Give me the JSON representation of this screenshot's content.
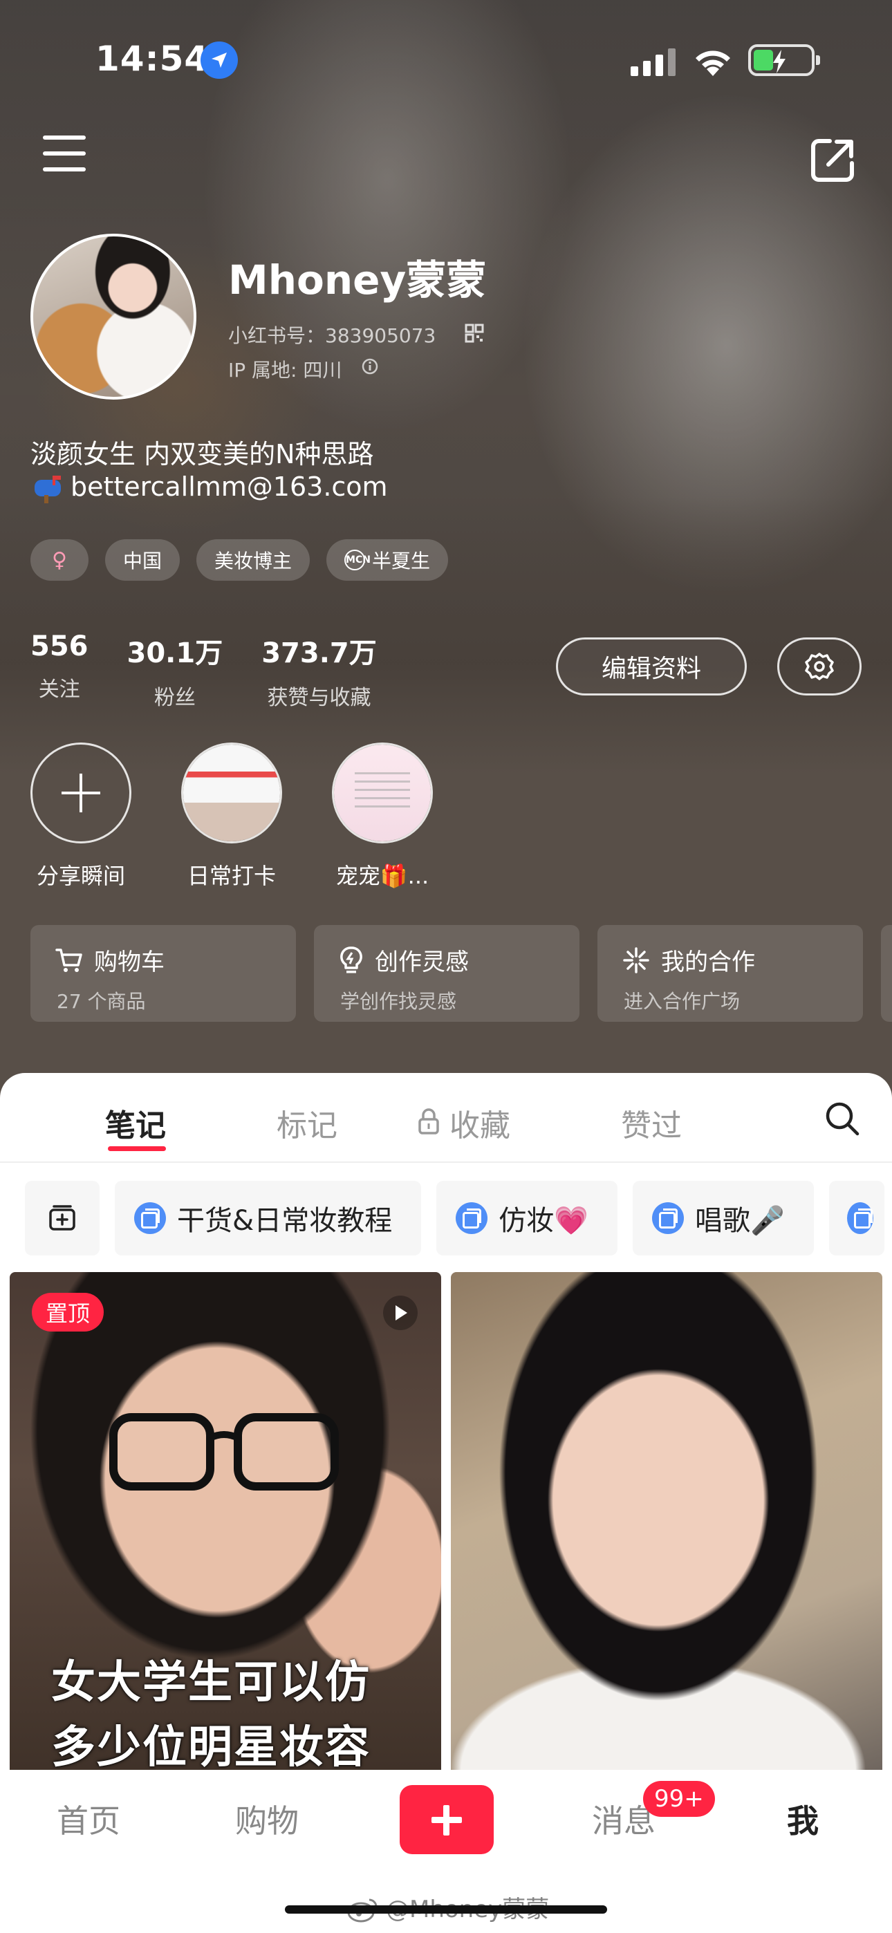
{
  "status_bar": {
    "time": "14:54"
  },
  "profile": {
    "name": "Mhoney蒙蒙",
    "redbook_id": "小红书号：383905073",
    "ip_location": "IP 属地: 四川",
    "bio_line1": "淡颜女生 内双变美的N种思路",
    "bio_line2": "bettercallmm@163.com",
    "tags": [
      "中国",
      "美妆博主",
      "半夏生"
    ],
    "gender_symbol": "♀"
  },
  "stats": [
    {
      "value": "556",
      "label": "关注"
    },
    {
      "value": "30.1万",
      "label": "粉丝"
    },
    {
      "value": "373.7万",
      "label": "获赞与收藏"
    }
  ],
  "buttons": {
    "edit_profile": "编辑资料"
  },
  "highlights": [
    {
      "label": "分享瞬间"
    },
    {
      "label": "日常打卡"
    },
    {
      "label": "宠宠🎁..."
    }
  ],
  "cards": [
    {
      "title": "购物车",
      "subtitle": "27 个商品",
      "icon": "cart-icon"
    },
    {
      "title": "创作灵感",
      "subtitle": "学创作找灵感",
      "icon": "lightbulb-icon"
    },
    {
      "title": "我的合作",
      "subtitle": "进入合作广场",
      "icon": "sparkle-icon"
    }
  ],
  "content_tabs": [
    "笔记",
    "标记",
    "收藏",
    "赞过"
  ],
  "collections": [
    "干货&日常妆教程",
    "仿妆💗",
    "唱歌🎤"
  ],
  "posts": [
    {
      "pin_label": "置顶",
      "caption_line1": "女大学生可以仿",
      "caption_line2": "多少位明星妆容"
    }
  ],
  "tabbar": {
    "items": [
      "首页",
      "购物",
      "消息",
      "我"
    ],
    "message_badge": "99+"
  },
  "watermark": "@Mhoney蒙蒙",
  "colors": {
    "accent": "#ff2442",
    "collection_icon": "#4f8ef7",
    "location": "#2f7df6"
  }
}
